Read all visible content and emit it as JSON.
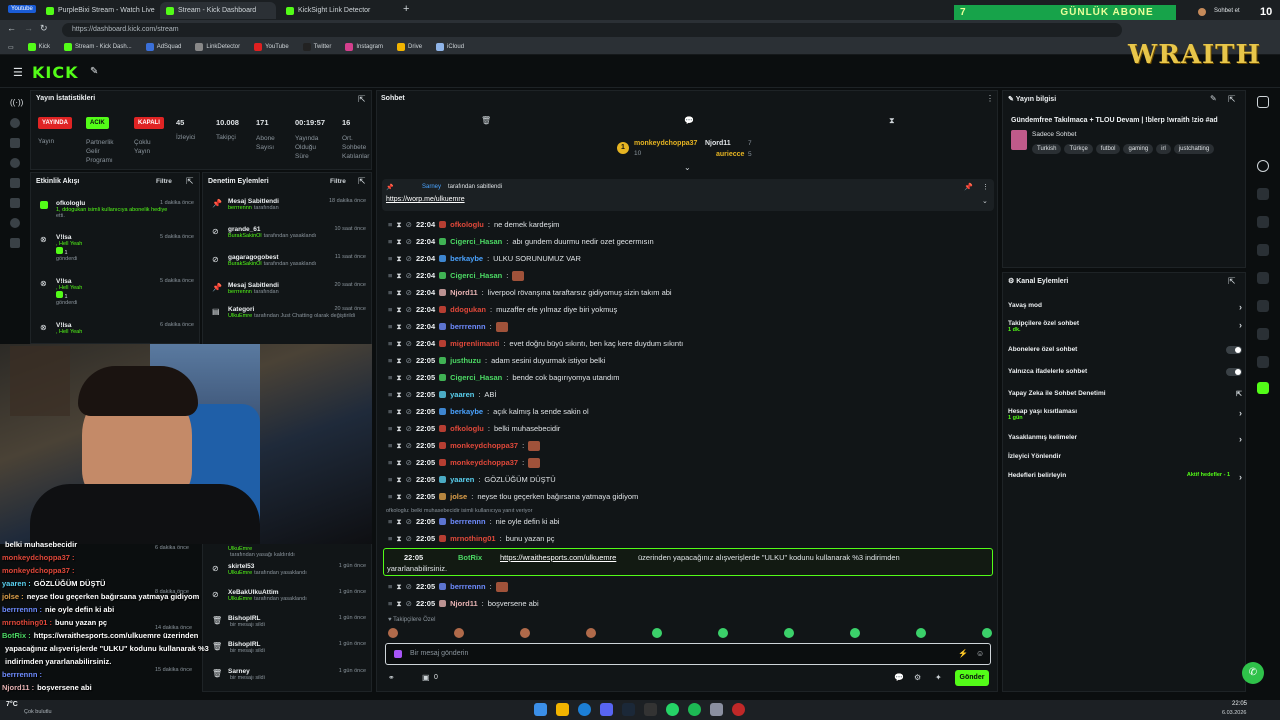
{
  "browser": {
    "tabs": [
      "PurpleBixi Stream - Watch Live",
      "Stream - Kick Dashboard",
      "KickSight Link Detector"
    ],
    "url": "https://dashboard.kick.com/stream",
    "youtube_badge": "Youtube",
    "profile": "Sohbet et",
    "bookmarks": [
      "Kick",
      "Stream - Kick Dash...",
      "AdSquad",
      "LinkDetector",
      "YouTube",
      "Twitter",
      "Instagram",
      "Drive",
      "iCloud"
    ]
  },
  "overlay": {
    "sub_goal_count": "7",
    "sub_goal_label": "GÜNLÜK ABONE",
    "sub_goal_target": "10",
    "streamer_logo": "WRAITH"
  },
  "header": {
    "logo": "KICK"
  },
  "stats": {
    "title": "Yayın İstatistikleri",
    "items": [
      {
        "value": "YAYINDA",
        "label": "Yayın"
      },
      {
        "value": "ACIK",
        "label": "Partnerlik Gelir Programı"
      },
      {
        "value": "KAPALI",
        "label": "Çoklu Yayın"
      },
      {
        "value": "45",
        "label": "İzleyici"
      },
      {
        "value": "10.008",
        "label": "Takipçi"
      },
      {
        "value": "171",
        "label": "Abone Sayısı"
      },
      {
        "value": "00:19:57",
        "label": "Yayında Olduğu Süre"
      },
      {
        "value": "16",
        "label": "Ort. Sohbete Katılanlar"
      }
    ]
  },
  "activity": {
    "title": "Etkinlik Akışı",
    "filter": "Filtre",
    "items": [
      {
        "name": "ofkologlu",
        "time": "1 dakika önce",
        "line1": "1, ddogukan isimli kullanıcıya abonelik hediye",
        "line2": "etti."
      },
      {
        "name": "V!lsa",
        "time": "5 dakika önce",
        "line1": ", Hell Yeah",
        "line2": "1",
        "line3": "gönderdi"
      },
      {
        "name": "V!lsa",
        "time": "5 dakika önce",
        "line1": ", Hell Yeah",
        "line2": "1",
        "line3": "gönderdi"
      },
      {
        "name": "V!lsa",
        "time": "6 dakika önce",
        "line1": ", Hell Yeah"
      }
    ]
  },
  "moderation": {
    "title": "Denetim Eylemleri",
    "filter": "Filtre",
    "items": [
      {
        "name": "Mesaj Sabitlendi",
        "time": "18 dakika önce",
        "actor": "berrrennn",
        "suffix": "tarafından"
      },
      {
        "name": "grande_61",
        "time": "10 saat önce",
        "actor": "BurakSakinOl",
        "suffix": "tarafından yasaklandı"
      },
      {
        "name": "gagaragogobest",
        "time": "11 saat önce",
        "actor": "BurakSakinOl",
        "suffix": "tarafından yasaklandı"
      },
      {
        "name": "Mesaj Sabitlendi",
        "time": "20 saat önce",
        "actor": "berrrennn",
        "suffix": "tarafından"
      },
      {
        "name": "Kategori",
        "time": "20 saat önce",
        "actor": "UlkuEmre",
        "suffix": "tarafından Just Chatting olarak değiştirildi"
      }
    ],
    "lower_items": [
      {
        "name": "UlkuEmre",
        "time": "",
        "actor": "",
        "suffix": "tarafından yasağı kaldırıldı"
      },
      {
        "name": "skirtel53",
        "time": "1 gün önce",
        "actor": "UlkuEmre",
        "suffix": "tarafından yasaklandı"
      },
      {
        "name": "XeBakUlkuAttim",
        "time": "1 gün önce",
        "actor": "UlkuEmre",
        "suffix": "tarafından yasaklandı"
      },
      {
        "name": "BishopIRL",
        "time": "1 gün önce",
        "actor": "",
        "suffix": "bir mesajı sildi"
      },
      {
        "name": "BishopIRL",
        "time": "1 gün önce",
        "actor": "",
        "suffix": "bir mesajı sildi"
      },
      {
        "name": "Sarney",
        "time": "1 gün önce",
        "actor": "",
        "suffix": "bir mesajı sildi"
      }
    ],
    "lower_times": [
      "6 dakika önce",
      "8 dakika önce",
      "14 dakika önce",
      "15 dakika önce"
    ]
  },
  "chat": {
    "title": "Sohbet",
    "top_gifters": [
      {
        "rank": "1",
        "name": "monkeydchoppa37",
        "count": "10"
      },
      {
        "rank": "",
        "name": "Njord11",
        "count": "7"
      },
      {
        "rank": "",
        "name": "auriecce",
        "count": "5"
      }
    ],
    "pinned_by": "Sarney",
    "pinned_label": "tarafından sabitlendi",
    "pinned_link": "https://worp.me/ulkuemre",
    "messages": [
      {
        "time": "22:04",
        "user": "ofkologlu",
        "color": "#e0483a",
        "text": "ne demek kardeşim"
      },
      {
        "time": "22:04",
        "user": "Cigerci_Hasan",
        "color": "#4cd964",
        "text": "abı gundem duurmu nedir ozet gecermısın"
      },
      {
        "time": "22:04",
        "user": "berkaybe",
        "color": "#4aa3ff",
        "text": "ULKU SORUNUMUZ VAR"
      },
      {
        "time": "22:04",
        "user": "Cigerci_Hasan",
        "color": "#4cd964",
        "text": ""
      },
      {
        "time": "22:04",
        "user": "Njord11",
        "color": "#e6b2b2",
        "text": "liverpool rövanşına taraftarsız gidiyomuş sizin takım abi"
      },
      {
        "time": "22:04",
        "user": "ddogukan",
        "color": "#e0483a",
        "text": "muzaffer efe yılmaz diye biri yokmuş"
      },
      {
        "time": "22:04",
        "user": "berrrennn",
        "color": "#6f8cff",
        "text": ""
      },
      {
        "time": "22:04",
        "user": "migrenlimanti",
        "color": "#e0483a",
        "text": "evet doğru büyü sıkıntı, ben kaç kere duydum sıkıntı"
      },
      {
        "time": "22:05",
        "user": "justhuzu",
        "color": "#4cd964",
        "text": "adam sesini duyurmak istiyor belki"
      },
      {
        "time": "22:05",
        "user": "Cigerci_Hasan",
        "color": "#4cd964",
        "text": "bende cok bagırıyomya utandım"
      },
      {
        "time": "22:05",
        "user": "yaaren",
        "color": "#5ad1f0",
        "text": "ABİ"
      },
      {
        "time": "22:05",
        "user": "berkaybe",
        "color": "#4aa3ff",
        "text": "açık kalmış la sende sakin ol"
      },
      {
        "time": "22:05",
        "user": "ofkologlu",
        "color": "#e0483a",
        "text": "belki muhasebecidir"
      },
      {
        "time": "22:05",
        "user": "monkeydchoppa37",
        "color": "#e0483a",
        "text": ""
      },
      {
        "time": "22:05",
        "user": "monkeydchoppa37",
        "color": "#e0483a",
        "text": ""
      },
      {
        "time": "22:05",
        "user": "yaaren",
        "color": "#5ad1f0",
        "text": "GÖZLÜĞÜM DÜŞTÜ"
      },
      {
        "time": "22:05",
        "user": "jolse",
        "color": "#e0a14a",
        "text": "neyse tlou geçerken bağırsana yatmaya gidiyom"
      }
    ],
    "reply_note": "ofkologlu: belki muhasebecidir isimli kullanıcıya yanıt veriyor",
    "messages2": [
      {
        "time": "22:05",
        "user": "berrrennn",
        "color": "#6f8cff",
        "text": "nie oyle defin ki abi"
      },
      {
        "time": "22:05",
        "user": "mrnothing01",
        "color": "#e0483a",
        "text": "bunu yazan pç"
      }
    ],
    "bot": {
      "time": "22:05",
      "user": "BotRix",
      "link": "https://wraithesports.com/ulkuemre",
      "text": "üzerinden yapacağınız alışverişlerde \"ULKU\" kodunu kullanarak %3 indirimden",
      "text2": "yararlanabilirsiniz."
    },
    "messages3": [
      {
        "time": "22:05",
        "user": "berrrennn",
        "color": "#6f8cff",
        "text": ""
      },
      {
        "time": "22:05",
        "user": "Njord11",
        "color": "#e6b2b2",
        "text": "boşversene abi"
      }
    ],
    "followers_only": "Takipçilere Özel",
    "input_placeholder": "Bir mesaj gönderin",
    "footer_count": "0",
    "send": "Gönder"
  },
  "stream_info": {
    "title": "Yayın bilgisi",
    "stream_title": "Gündemfree Takılmaca + TLOU Devam | !blerp !wraith !zio #ad",
    "category": "Sadece Sohbet",
    "tags": [
      "Turkish",
      "Türkçe",
      "futbol",
      "gaming",
      "irl",
      "justchatting"
    ]
  },
  "channel_actions": {
    "title": "Kanal Eylemleri",
    "rows": [
      {
        "label": "Yavaş mod",
        "sub": ""
      },
      {
        "label": "Takipçilere özel sohbet",
        "sub": "1 dk."
      },
      {
        "label": "Abonelere özel sohbet",
        "sub": ""
      },
      {
        "label": "Yalnızca ifadelerle sohbet",
        "sub": ""
      },
      {
        "label": "Yapay Zeka ile Sohbet Denetimi",
        "sub": ""
      },
      {
        "label": "Hesap yaşı kısıtlaması",
        "sub": "1 gün"
      },
      {
        "label": "Yasaklanmış kelimeler",
        "sub": ""
      },
      {
        "label": "İzleyici Yönlendir",
        "sub": ""
      },
      {
        "label": "Hedefleri belirleyin",
        "sub": ""
      }
    ],
    "goals_status": "Aktif hedefler - 1"
  },
  "stream_overlay_chat": [
    {
      "user": "",
      "color": "#e0483a",
      "text": "belki muhasebecidir"
    },
    {
      "user": "monkeydchoppa37 :",
      "color": "#e0483a",
      "text": ""
    },
    {
      "user": "monkeydchoppa37 :",
      "color": "#e0483a",
      "text": ""
    },
    {
      "user": "yaaren :",
      "color": "#5ad1f0",
      "text": "GÖZLÜĞÜM DÜŞTÜ"
    },
    {
      "user": "jolse :",
      "color": "#e0a14a",
      "text": "neyse tlou geçerken bağırsana yatmaya gidiyom"
    },
    {
      "user": "berrrennn :",
      "color": "#6f8cff",
      "text": "nie oyle defin ki abi"
    },
    {
      "user": "mrnothing01 :",
      "color": "#e0483a",
      "text": "bunu yazan pç"
    },
    {
      "user": "BotRix :",
      "color": "#4cd964",
      "text": "https://wraithesports.com/ulkuemre üzerinden"
    },
    {
      "user": "",
      "color": "#fff",
      "text": "yapacağınız alışverişlerde \"ULKU\" kodunu kullanarak %3"
    },
    {
      "user": "",
      "color": "#fff",
      "text": "indirimden yararlanabilirsiniz."
    },
    {
      "user": "berrrennn :",
      "color": "#6f8cff",
      "text": ""
    },
    {
      "user": "Njord11 :",
      "color": "#e6b2b2",
      "text": "boşversene abi"
    }
  ],
  "taskbar": {
    "weather": "7°C",
    "weather_desc": "Çok bulutlu",
    "time": "22:05",
    "date": "6.03.2026"
  }
}
